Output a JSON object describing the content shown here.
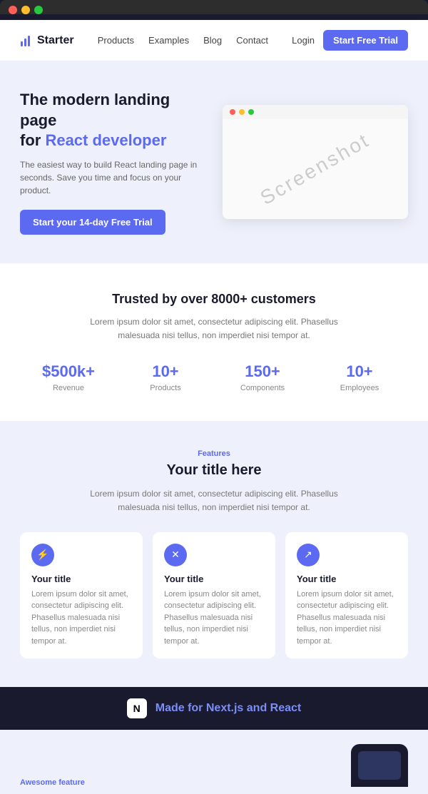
{
  "browser": {
    "dots": [
      "red",
      "yellow",
      "green"
    ]
  },
  "navbar": {
    "logo_text": "Starter",
    "links": [
      "Products",
      "Examples",
      "Blog",
      "Contact"
    ],
    "login_label": "Login",
    "cta_label": "Start Free Trial"
  },
  "hero": {
    "title_line1": "The modern landing page",
    "title_line2": "for ",
    "title_highlight": "React developer",
    "description": "The easiest way to build React landing page in seconds. Save you time and focus on your product.",
    "cta_label": "Start your 14-day Free Trial",
    "screenshot_text": "Screenshot"
  },
  "trusted": {
    "title": "Trusted by over 8000+ customers",
    "description": "Lorem ipsum dolor sit amet, consectetur adipiscing elit. Phasellus malesuada nisi tellus, non imperdiet nisi tempor at.",
    "stats": [
      {
        "value": "$500k+",
        "label": "Revenue"
      },
      {
        "value": "10+",
        "label": "Products"
      },
      {
        "value": "150+",
        "label": "Components"
      },
      {
        "value": "10+",
        "label": "Employees"
      }
    ]
  },
  "features": {
    "tag": "Features",
    "title": "Your title here",
    "description": "Lorem ipsum dolor sit amet, consectetur adipiscing elit. Phasellus malesuada nisi tellus, non imperdiet nisi tempor at.",
    "cards": [
      {
        "icon": "⚡",
        "title": "Your title",
        "description": "Lorem ipsum dolor sit amet, consectetur adipiscing elit. Phasellus malesuada nisi tellus, non imperdiet nisi tempor at."
      },
      {
        "icon": "✕",
        "title": "Your title",
        "description": "Lorem ipsum dolor sit amet, consectetur adipiscing elit. Phasellus malesuada nisi tellus, non imperdiet nisi tempor at."
      },
      {
        "icon": "↗",
        "title": "Your title",
        "description": "Lorem ipsum dolor sit amet, consectetur adipiscing elit. Phasellus malesuada nisi tellus, non imperdiet nisi tempor at."
      }
    ]
  },
  "nextjs_banner": {
    "icon": "N",
    "text_prefix": "Made for ",
    "text_highlight": "Next.js and React"
  },
  "bottom": {
    "awesome_label": "Awesome feature"
  }
}
